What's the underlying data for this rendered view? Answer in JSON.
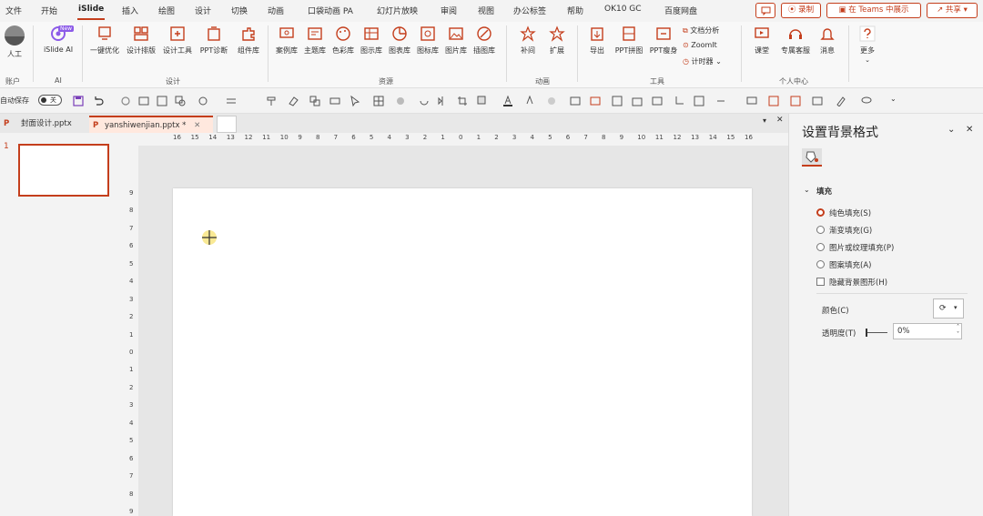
{
  "menu": {
    "tabs": [
      "文件",
      "开始",
      "iSlide",
      "插入",
      "绘图",
      "设计",
      "切换",
      "动画",
      "口袋动画 PA",
      "幻灯片放映",
      "审阅",
      "视图",
      "办公标签",
      "帮助",
      "OK10 GC",
      "百度网盘"
    ],
    "active": "iSlide",
    "comment_label": "▢",
    "record_label": "录制",
    "teams_label": "在 Teams 中展示",
    "share_label": "共享"
  },
  "ribbon": {
    "account": {
      "label": "人工",
      "group": "账户"
    },
    "ai": {
      "label": "iSlide AI",
      "group": "AI",
      "badge": "New"
    },
    "design_group": "设计",
    "design_items": [
      "一键优化",
      "设计排版",
      "设计工具",
      "PPT诊断",
      "组件库"
    ],
    "resource_group": "资源",
    "resource_items": [
      "案例库",
      "主题库",
      "色彩库",
      "图示库",
      "图表库",
      "图标库",
      "图片库",
      "插图库"
    ],
    "anim_group": "动画",
    "anim_items": [
      "补间",
      "扩展"
    ],
    "tools_group": "工具",
    "tools_items": [
      "导出",
      "PPT拼图",
      "PPT瘦身"
    ],
    "tools_small": [
      "文档分析",
      "ZoomIt",
      "计时器"
    ],
    "personal_group": "个人中心",
    "personal_items": [
      "课堂",
      "专属客服",
      "消息"
    ],
    "more_label": "更多"
  },
  "qat": {
    "autosave_label": "自动保存",
    "toggle_state": "关"
  },
  "doctabs": [
    {
      "name": "封面设计.pptx",
      "active": false
    },
    {
      "name": "yanshiwenjian.pptx *",
      "active": true
    }
  ],
  "thumbs": {
    "slide_number": "1"
  },
  "ruler": {
    "h_labels": [
      "16",
      "15",
      "14",
      "13",
      "12",
      "11",
      "10",
      "9",
      "8",
      "7",
      "6",
      "5",
      "4",
      "3",
      "2",
      "1",
      "0",
      "1",
      "2",
      "3",
      "4",
      "5",
      "6",
      "7",
      "8",
      "9",
      "10",
      "11",
      "12",
      "13",
      "14",
      "15",
      "16"
    ],
    "v_labels": [
      "9",
      "8",
      "7",
      "6",
      "5",
      "4",
      "3",
      "2",
      "1",
      "0",
      "1",
      "2",
      "3",
      "4",
      "5",
      "6",
      "7",
      "8",
      "9"
    ]
  },
  "pane": {
    "title": "设置背景格式",
    "section": "填充",
    "options": [
      {
        "label": "纯色填充(S)",
        "selected": true
      },
      {
        "label": "渐变填充(G)",
        "selected": false
      },
      {
        "label": "图片或纹理填充(P)",
        "selected": false
      },
      {
        "label": "图案填充(A)",
        "selected": false
      }
    ],
    "hide_bg": "隐藏背景图形(H)",
    "color_label": "颜色(C)",
    "transparency_label": "透明度(T)",
    "transparency_value": "0%"
  },
  "colors": {
    "accent": "#c43e1c",
    "ribbon_icon": "#c43e1c"
  }
}
